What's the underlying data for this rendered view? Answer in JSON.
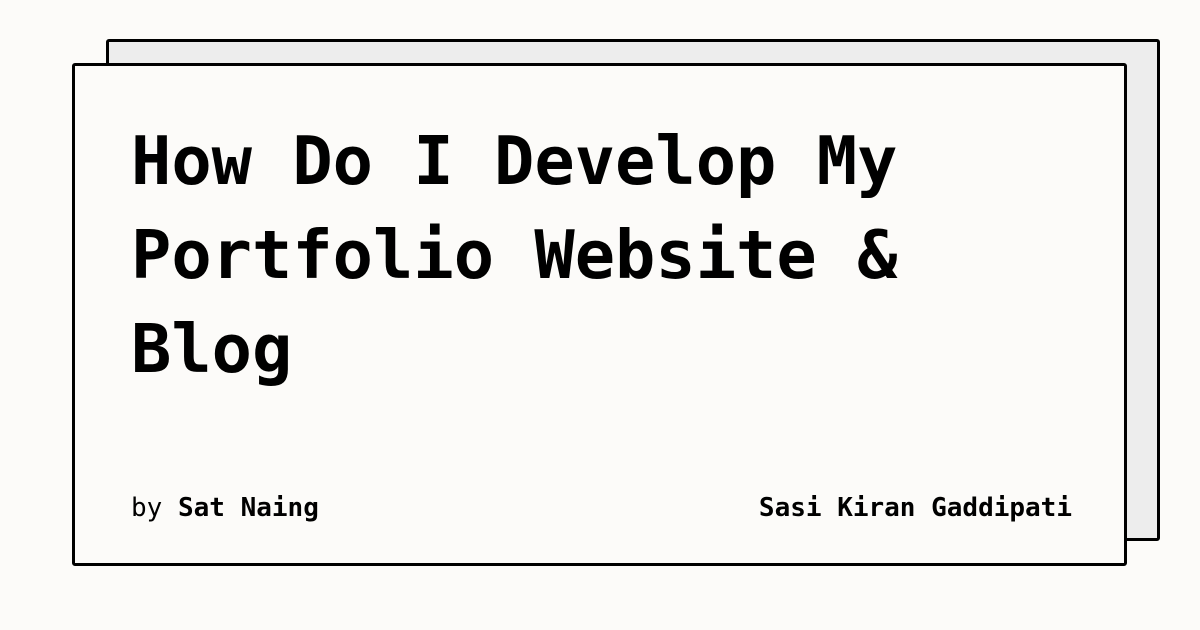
{
  "post": {
    "title": "How Do I Develop My Portfolio Website & Blog",
    "byline_prefix": "by",
    "author": "Sat Naing",
    "site_name": "Sasi Kiran Gaddipati"
  },
  "colors": {
    "page_background": "#fcfbf9",
    "card_background": "#fcfbf9",
    "shadow_card_background": "#ededed",
    "border": "#000000",
    "text": "#000000"
  }
}
